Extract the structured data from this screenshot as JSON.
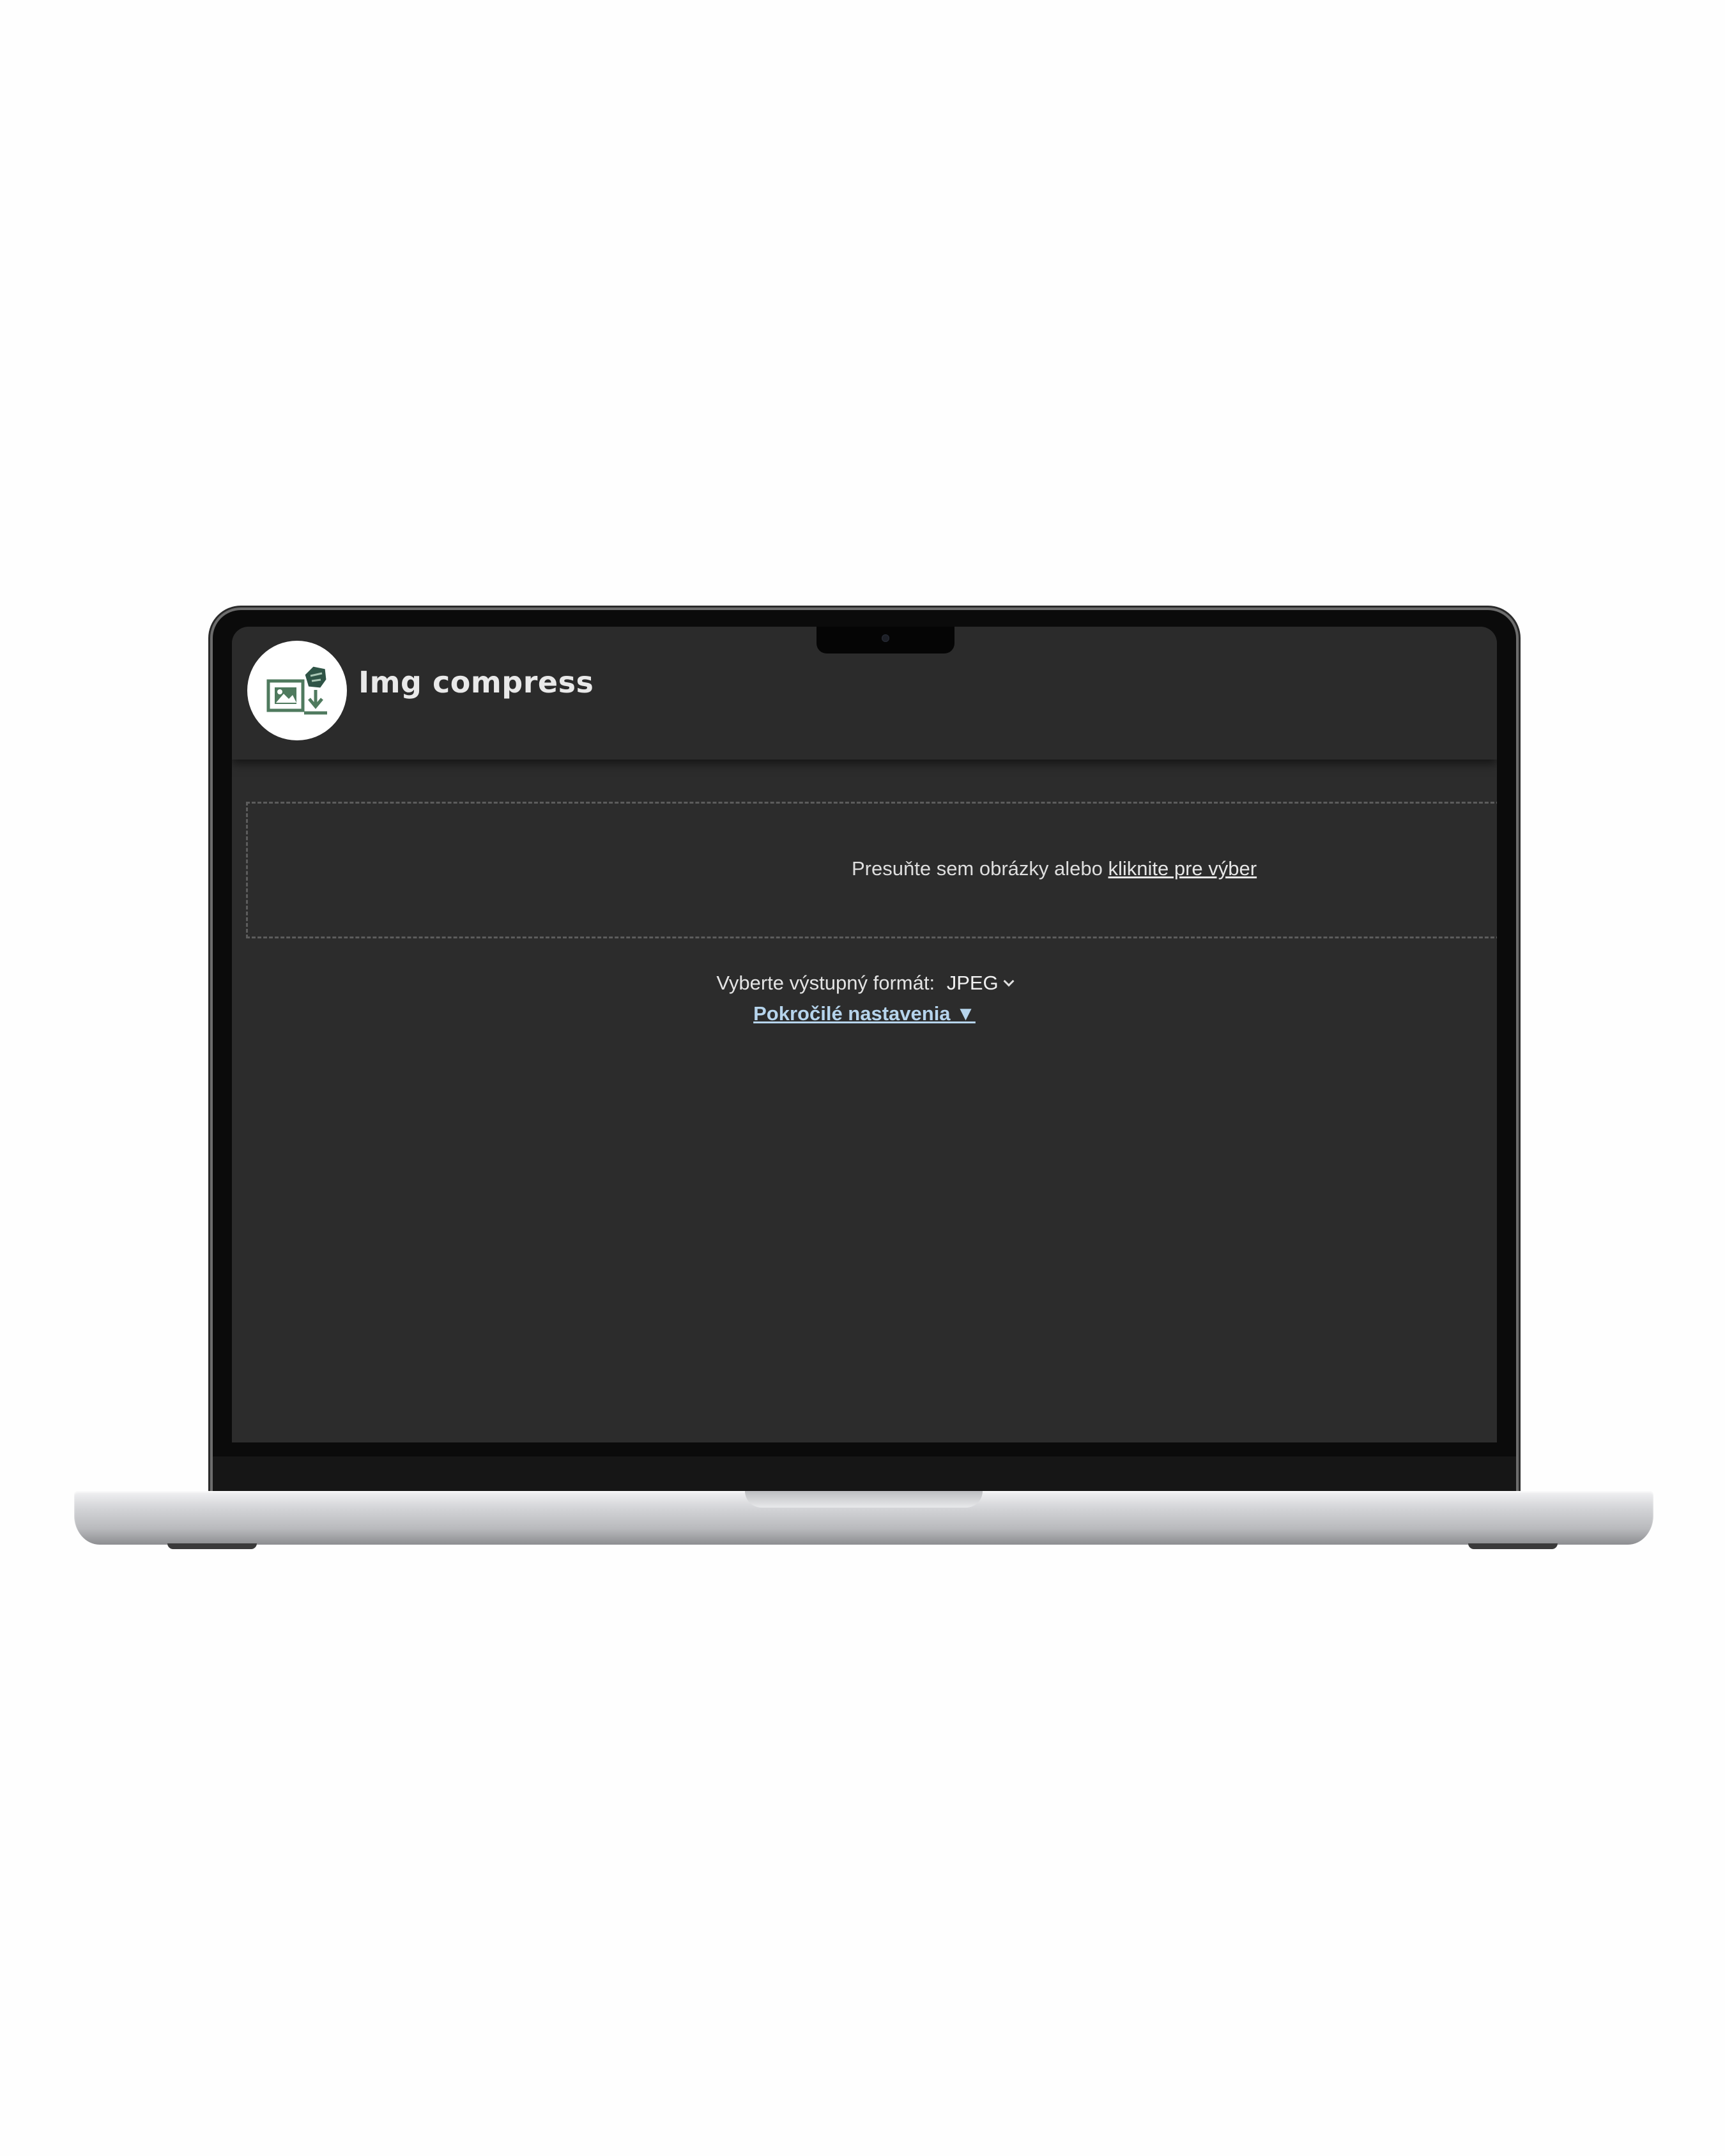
{
  "app": {
    "title": "Img compress",
    "logo_icon": "image-compress-icon",
    "brand_color": "#4f7a5e"
  },
  "dropzone": {
    "text": "Presuňte sem obrázky alebo",
    "link_text": "kliknite pre výber"
  },
  "format": {
    "label": "Vyberte výstupný formát:",
    "selected": "JPEG"
  },
  "advanced": {
    "label": "Pokročilé nastavenia ▼",
    "color": "#b6d4ec"
  }
}
